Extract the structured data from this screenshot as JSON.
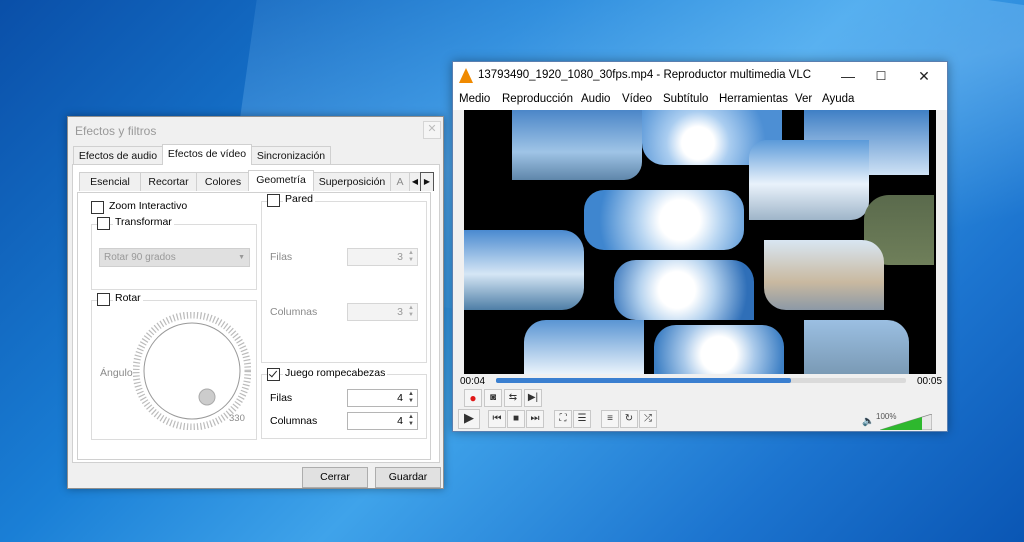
{
  "effects": {
    "title": "Efectos y filtros",
    "close_glyph": "✕",
    "main_tabs": [
      "Efectos de audio",
      "Efectos de vídeo",
      "Sincronización"
    ],
    "sub_tabs": [
      "Esencial",
      "Recortar",
      "Colores",
      "Geometría",
      "Superposición",
      "A"
    ],
    "zoom_label": "Zoom Interactivo",
    "transform_label": "Transformar",
    "transform_combo": "Rotar 90 grados",
    "rotate_label": "Rotar",
    "angle_label": "Ángulo",
    "angle_value": "330",
    "wall_label": "Pared",
    "wall_rows_label": "Filas",
    "wall_rows_value": "3",
    "wall_cols_label": "Columnas",
    "wall_cols_value": "3",
    "puzzle_label": "Juego rompecabezas",
    "puzzle_rows_label": "Filas",
    "puzzle_rows_value": "4",
    "puzzle_cols_label": "Columnas",
    "puzzle_cols_value": "4",
    "close_button": "Cerrar",
    "save_button": "Guardar"
  },
  "vlc": {
    "title": "13793490_1920_1080_30fps.mp4 - Reproductor multimedia VLC",
    "menus": [
      "Medio",
      "Reproducción",
      "Audio",
      "Vídeo",
      "Subtítulo",
      "Herramientas",
      "Ver",
      "Ayuda"
    ],
    "time_elapsed": "00:04",
    "time_total": "00:05",
    "progress": 0.72,
    "volume_label": "100%",
    "accent": "#3a7fd0"
  }
}
